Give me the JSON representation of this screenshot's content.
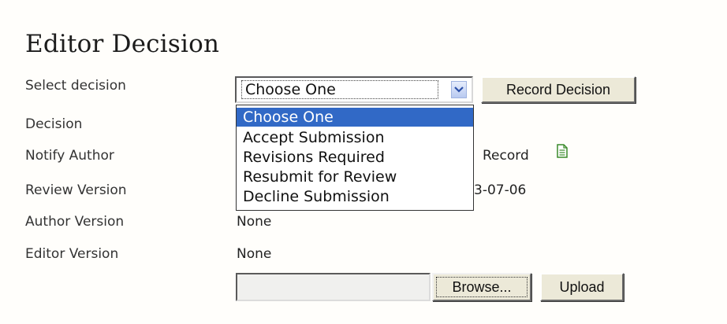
{
  "title": "Editor Decision",
  "labels": {
    "select_decision": "Select decision",
    "decision": "Decision",
    "notify_author": "Notify Author",
    "review_version": "Review Version",
    "author_version": "Author Version",
    "editor_version": "Editor Version"
  },
  "select": {
    "current_value": "Choose One",
    "options": [
      "Choose One",
      "Accept Submission",
      "Revisions Required",
      "Resubmit for Review",
      "Decline Submission"
    ],
    "highlighted_index": 0
  },
  "buttons": {
    "record_decision": "Record Decision",
    "browse": "Browse...",
    "upload": "Upload"
  },
  "values": {
    "notify_record_partial": "Record",
    "review_version_partial": "3-07-06",
    "author_version": "None",
    "editor_version": "None"
  },
  "icons": {
    "notify_record_icon": "document-icon",
    "select_arrow_icon": "chevron-down-icon"
  },
  "colors": {
    "highlight": "#3169c6",
    "button_face": "#ece9d8",
    "icon_green": "#3a8a2a"
  }
}
